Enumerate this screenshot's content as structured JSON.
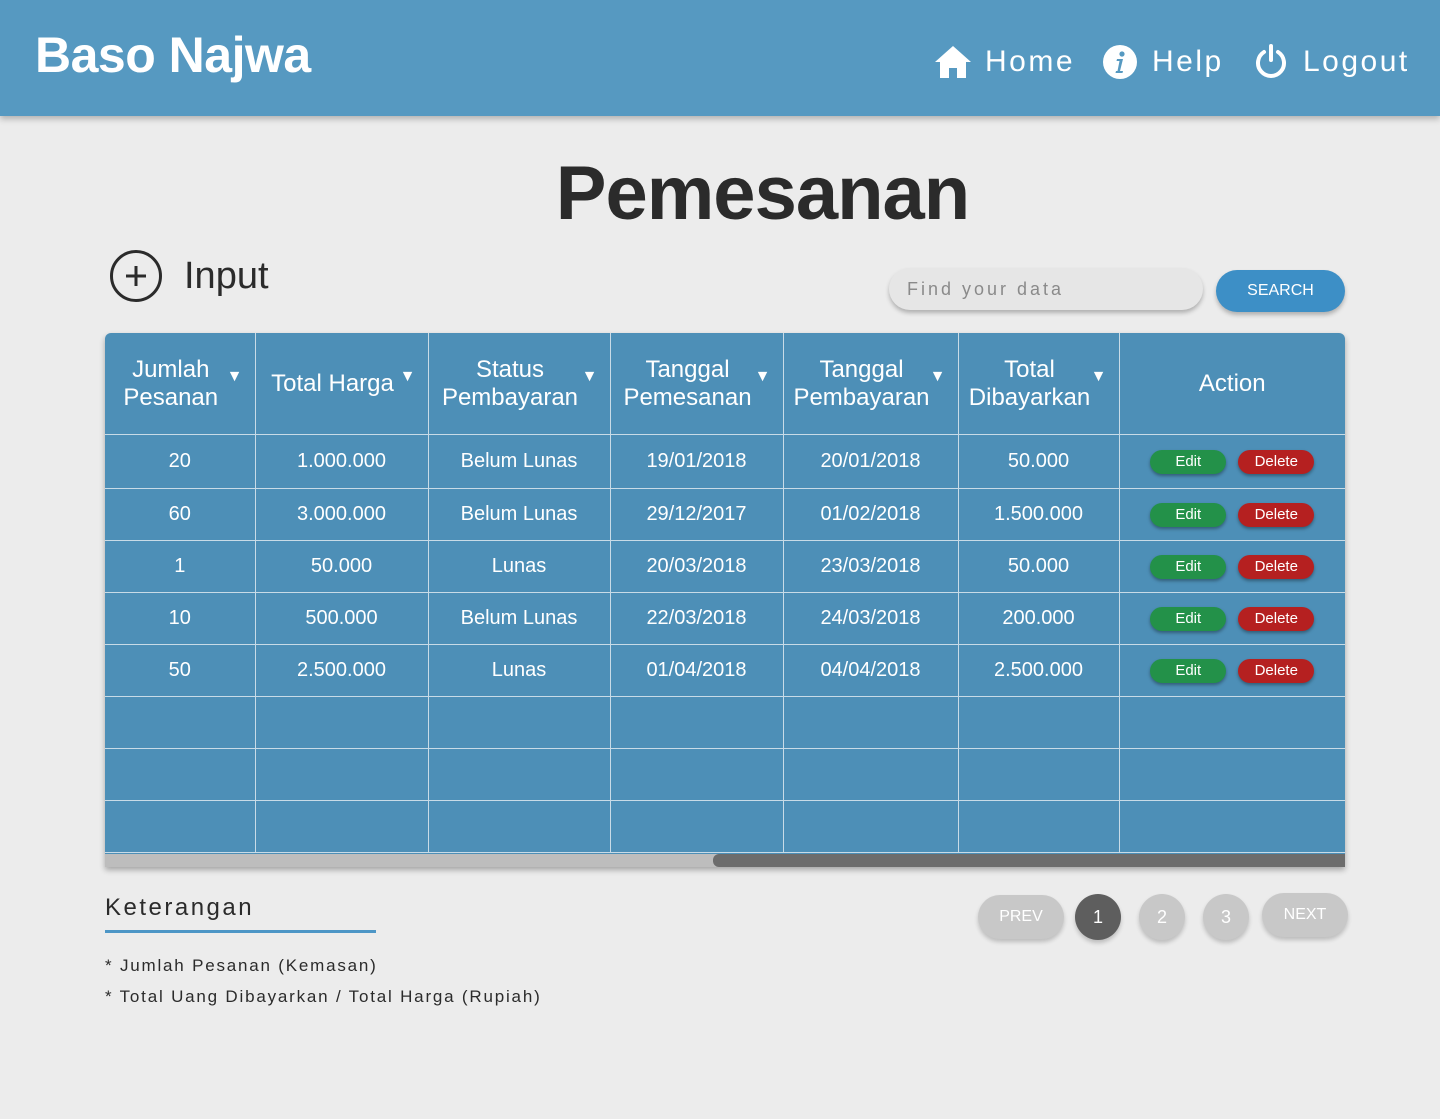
{
  "header": {
    "brand": "Baso Najwa",
    "nav": {
      "home": "Home",
      "help": "Help",
      "logout": "Logout"
    }
  },
  "page": {
    "title": "Pemesanan",
    "input_label": "Input"
  },
  "search": {
    "placeholder": "Find your data",
    "button": "SEARCH"
  },
  "table": {
    "columns": [
      {
        "line1": "Jumlah",
        "line2": "Pesanan",
        "sortable": true
      },
      {
        "line1": "Total Harga",
        "line2": "",
        "sortable": true
      },
      {
        "line1": "Status",
        "line2": "Pembayaran",
        "sortable": true
      },
      {
        "line1": "Tanggal",
        "line2": "Pemesanan",
        "sortable": true
      },
      {
        "line1": "Tanggal",
        "line2": "Pembayaran",
        "sortable": true
      },
      {
        "line1": "Total",
        "line2": "Dibayarkan",
        "sortable": true
      },
      {
        "line1": "Action",
        "line2": "",
        "sortable": false
      }
    ],
    "rows": [
      [
        "20",
        "1.000.000",
        "Belum Lunas",
        "19/01/2018",
        "20/01/2018",
        "50.000"
      ],
      [
        "60",
        "3.000.000",
        "Belum Lunas",
        "29/12/2017",
        "01/02/2018",
        "1.500.000"
      ],
      [
        "1",
        "50.000",
        "Lunas",
        "20/03/2018",
        "23/03/2018",
        "50.000"
      ],
      [
        "10",
        "500.000",
        "Belum Lunas",
        "22/03/2018",
        "24/03/2018",
        "200.000"
      ],
      [
        "50",
        "2.500.000",
        "Lunas",
        "01/04/2018",
        "04/04/2018",
        "2.500.000"
      ]
    ],
    "actions": {
      "edit": "Edit",
      "delete": "Delete"
    }
  },
  "keterangan": {
    "title": "Keterangan",
    "notes": [
      "* Jumlah Pesanan (Kemasan)",
      "* Total Uang Dibayarkan / Total Harga (Rupiah)"
    ]
  },
  "pagination": {
    "prev": "PREV",
    "pages": [
      "1",
      "2",
      "3"
    ],
    "next": "NEXT",
    "current": "1"
  },
  "colors": {
    "header": "#5699c1",
    "table": "#4d8fb7",
    "search_button": "#3d8fc6",
    "edit": "#239149",
    "delete": "#b52020"
  },
  "icons": {
    "home": "home-icon",
    "help": "info-icon",
    "logout": "power-icon",
    "input": "plus-circle-icon",
    "sort": "sort-down-icon"
  }
}
